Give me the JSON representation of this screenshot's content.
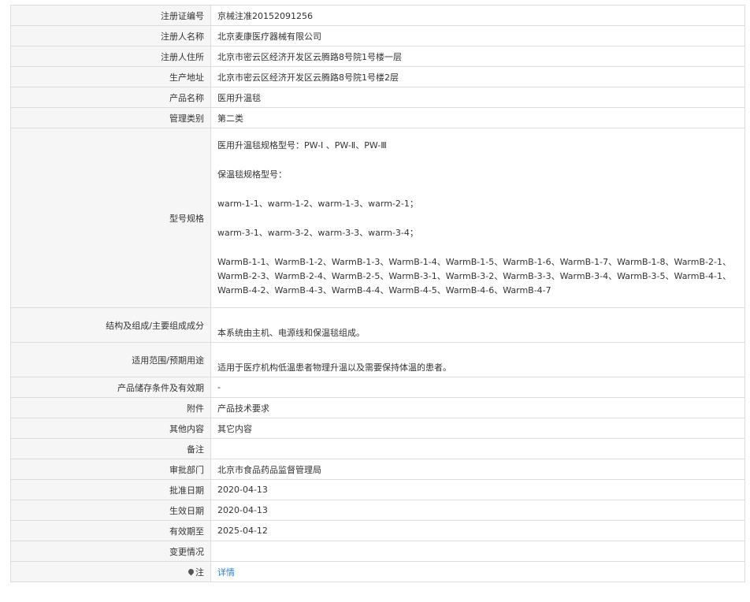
{
  "rows": {
    "reg_no": {
      "label": "注册证编号",
      "value": "京械注准20152091256"
    },
    "registrant": {
      "label": "注册人名称",
      "value": "北京麦康医疗器械有限公司"
    },
    "registrant_addr": {
      "label": "注册人住所",
      "value": "北京市密云区经济开发区云腾路8号院1号楼一层"
    },
    "prod_addr": {
      "label": "生产地址",
      "value": "北京市密云区经济开发区云腾路8号院1号楼2层"
    },
    "product_name": {
      "label": "产品名称",
      "value": "医用升温毯"
    },
    "category": {
      "label": "管理类别",
      "value": "第二类"
    },
    "spec": {
      "label": "型号规格",
      "lines": [
        "医用升温毯规格型号：PW-Ⅰ 、PW-Ⅱ、PW-Ⅲ",
        "保温毯规格型号：",
        "warm-1-1、warm-1-2、warm-1-3、warm-2-1；",
        "warm-3-1、warm-3-2、warm-3-3、warm-3-4；",
        "WarmB-1-1、WarmB-1-2、WarmB-1-3、WarmB-1-4、WarmB-1-5、WarmB-1-6、WarmB-1-7、WarmB-1-8、WarmB-2-1、",
        "WarmB-2-3、WarmB-2-4、WarmB-2-5、WarmB-3-1、WarmB-3-2、WarmB-3-3、WarmB-3-4、WarmB-3-5、WarmB-4-1、",
        "WarmB-4-2、WarmB-4-3、WarmB-4-4、WarmB-4-5、WarmB-4-6、WarmB-4-7"
      ]
    },
    "structure": {
      "label": "结构及组成/主要组成成分",
      "value": "本系统由主机、电源线和保温毯组成。"
    },
    "usage": {
      "label": "适用范围/预期用途",
      "value": "适用于医疗机构低温患者物理升温以及需要保持体温的患者。"
    },
    "storage": {
      "label": "产品储存条件及有效期",
      "value": "-"
    },
    "attachment": {
      "label": "附件",
      "value": "产品技术要求"
    },
    "other": {
      "label": "其他内容",
      "value": "其它内容"
    },
    "remark": {
      "label": "备注",
      "value": ""
    },
    "dept": {
      "label": "审批部门",
      "value": "北京市食品药品监督管理局"
    },
    "approve_date": {
      "label": "批准日期",
      "value": "2020-04-13"
    },
    "effective_date": {
      "label": "生效日期",
      "value": "2020-04-13"
    },
    "expire": {
      "label": "有效期至",
      "value": "2025-04-12"
    },
    "change": {
      "label": "变更情况",
      "value": ""
    },
    "note": {
      "label": "注",
      "link": "详情"
    }
  },
  "icons": {
    "note_icon": "map-pin-icon"
  },
  "colors": {
    "link": "#2a7fd4",
    "label_bg": "#f6f6f6",
    "border": "#dcdcdc"
  }
}
